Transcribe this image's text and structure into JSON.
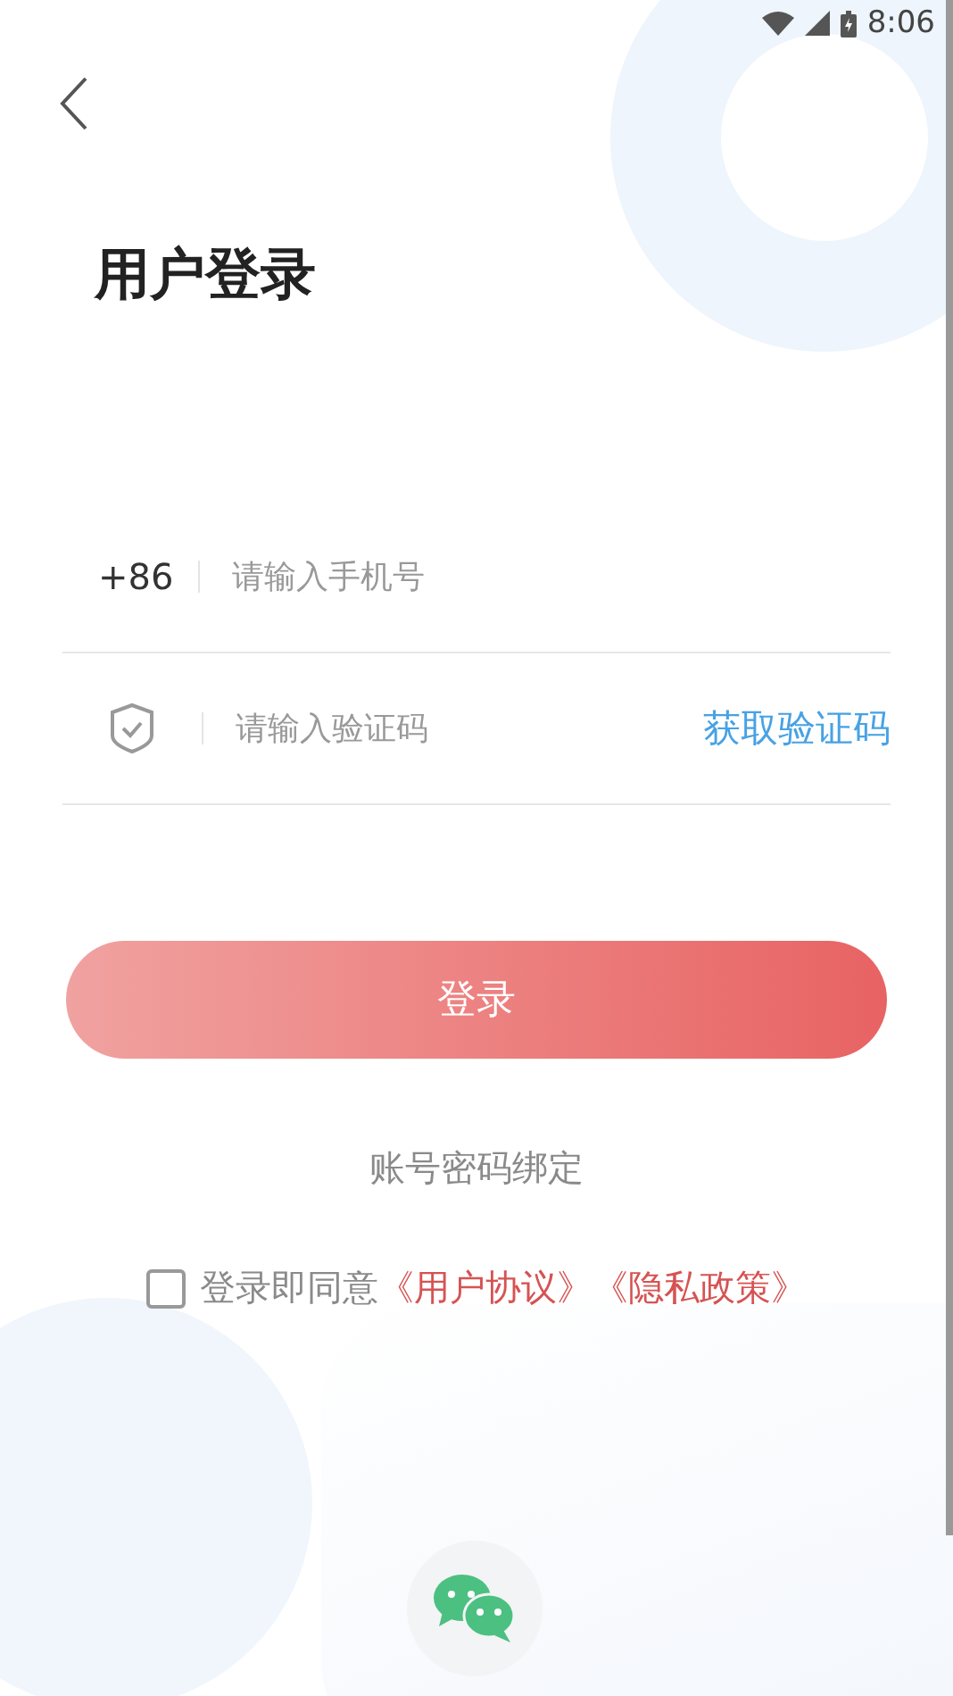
{
  "status_bar": {
    "time": "8:06"
  },
  "title": "用户登录",
  "phone_field": {
    "prefix": "+86",
    "placeholder": "请输入手机号"
  },
  "code_field": {
    "placeholder": "请输入验证码",
    "get_code": "获取验证码"
  },
  "login_button": "登录",
  "bind_link": "账号密码绑定",
  "agreement": {
    "checked": false,
    "text": "登录即同意",
    "links": [
      "《用户协议》",
      "《隐私政策》"
    ]
  }
}
